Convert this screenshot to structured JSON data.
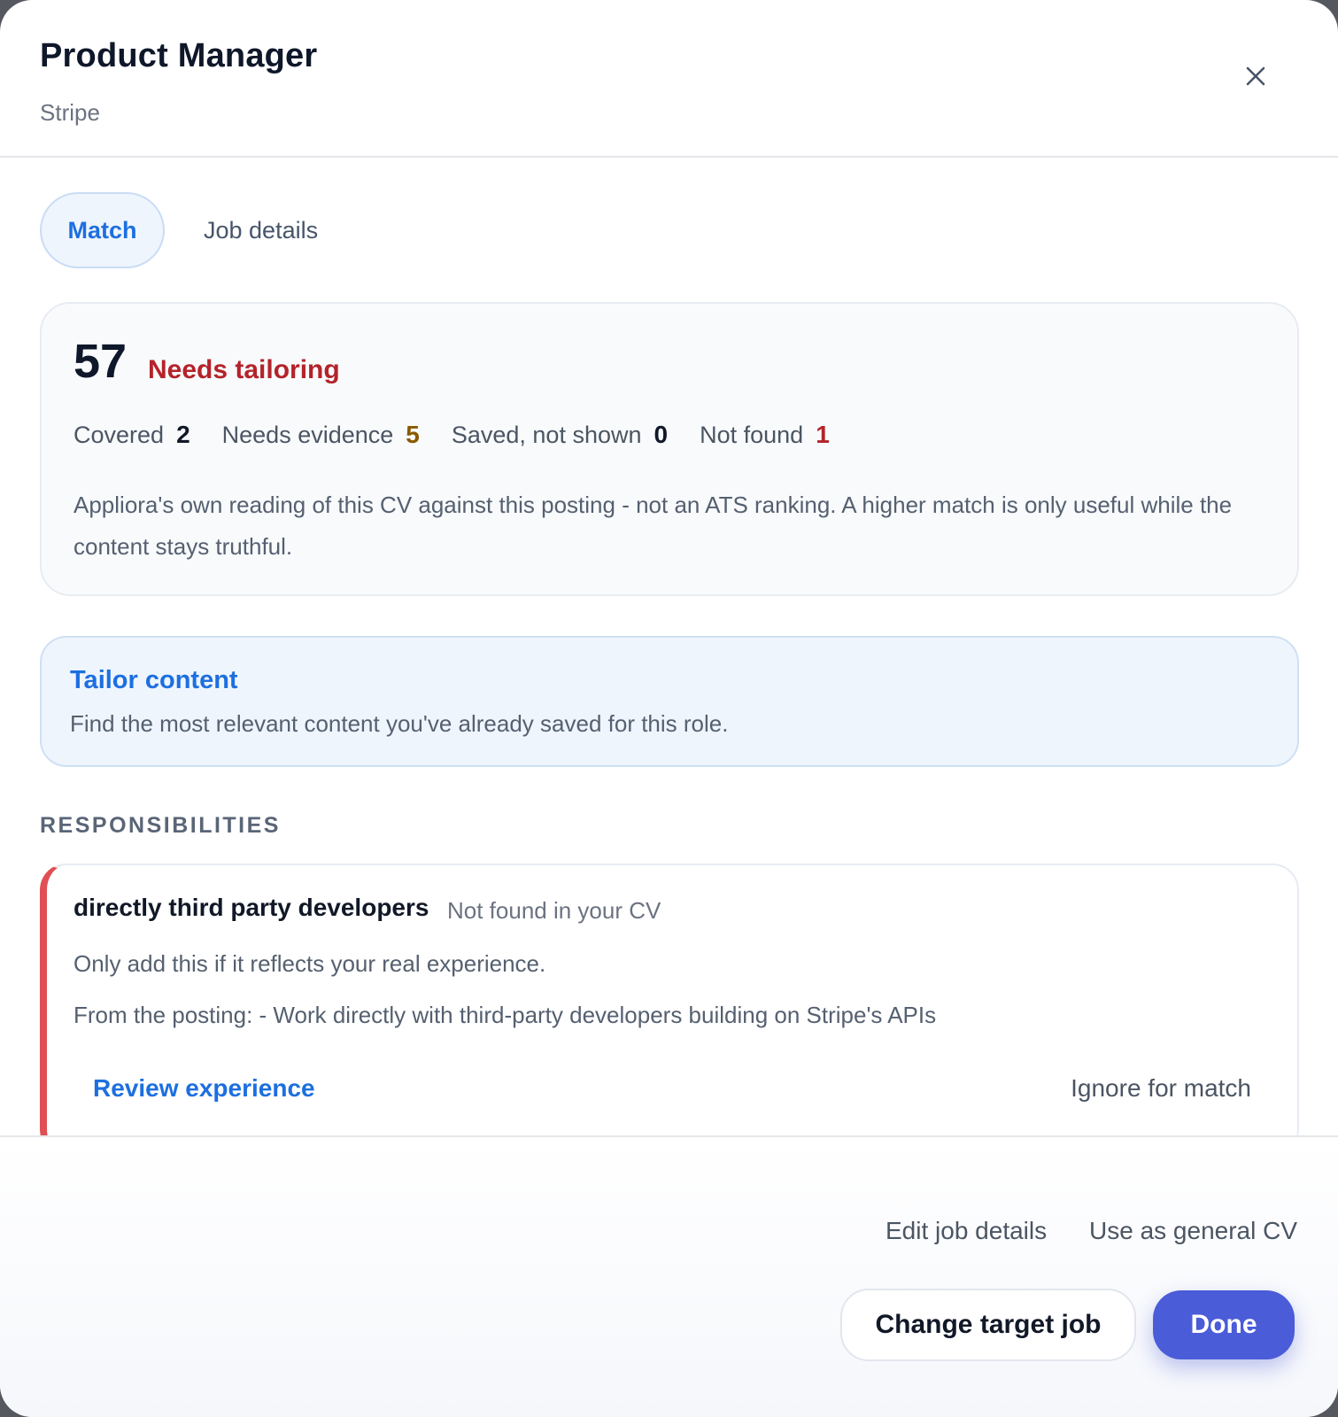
{
  "header": {
    "title": "Product Manager",
    "company": "Stripe",
    "close_icon": "close-icon"
  },
  "tabs": [
    {
      "label": "Match",
      "active": true
    },
    {
      "label": "Job details",
      "active": false
    }
  ],
  "score": {
    "value": "57",
    "status": "Needs tailoring",
    "status_color": "#b4232a",
    "stats": [
      {
        "label": "Covered",
        "value": "2",
        "color": "#111827"
      },
      {
        "label": "Needs evidence",
        "value": "5",
        "color": "#8a5a00"
      },
      {
        "label": "Saved, not shown",
        "value": "0",
        "color": "#111827"
      },
      {
        "label": "Not found",
        "value": "1",
        "color": "#b4232a"
      }
    ],
    "note": "Appliora's own reading of this CV against this posting - not an ATS ranking. A higher match is only useful while the content stays truthful."
  },
  "tailor": {
    "title": "Tailor content",
    "description": "Find the most relevant content you've already saved for this role."
  },
  "responsibilities": {
    "heading": "RESPONSIBILITIES",
    "items": [
      {
        "title": "directly third party developers",
        "status": "Not found in your CV",
        "guidance": "Only add this if it reflects your real experience.",
        "source": "From the posting: - Work directly with third-party developers building on Stripe's APIs",
        "primary_action": "Review experience",
        "secondary_action": "Ignore for match",
        "accent_color": "#e04f54"
      }
    ]
  },
  "footer": {
    "edit_link": "Edit job details",
    "general_link": "Use as general CV",
    "change_button": "Change target job",
    "done_button": "Done"
  },
  "colors": {
    "accent": "#1d6fe0",
    "primary_button": "#4a5cd8"
  }
}
